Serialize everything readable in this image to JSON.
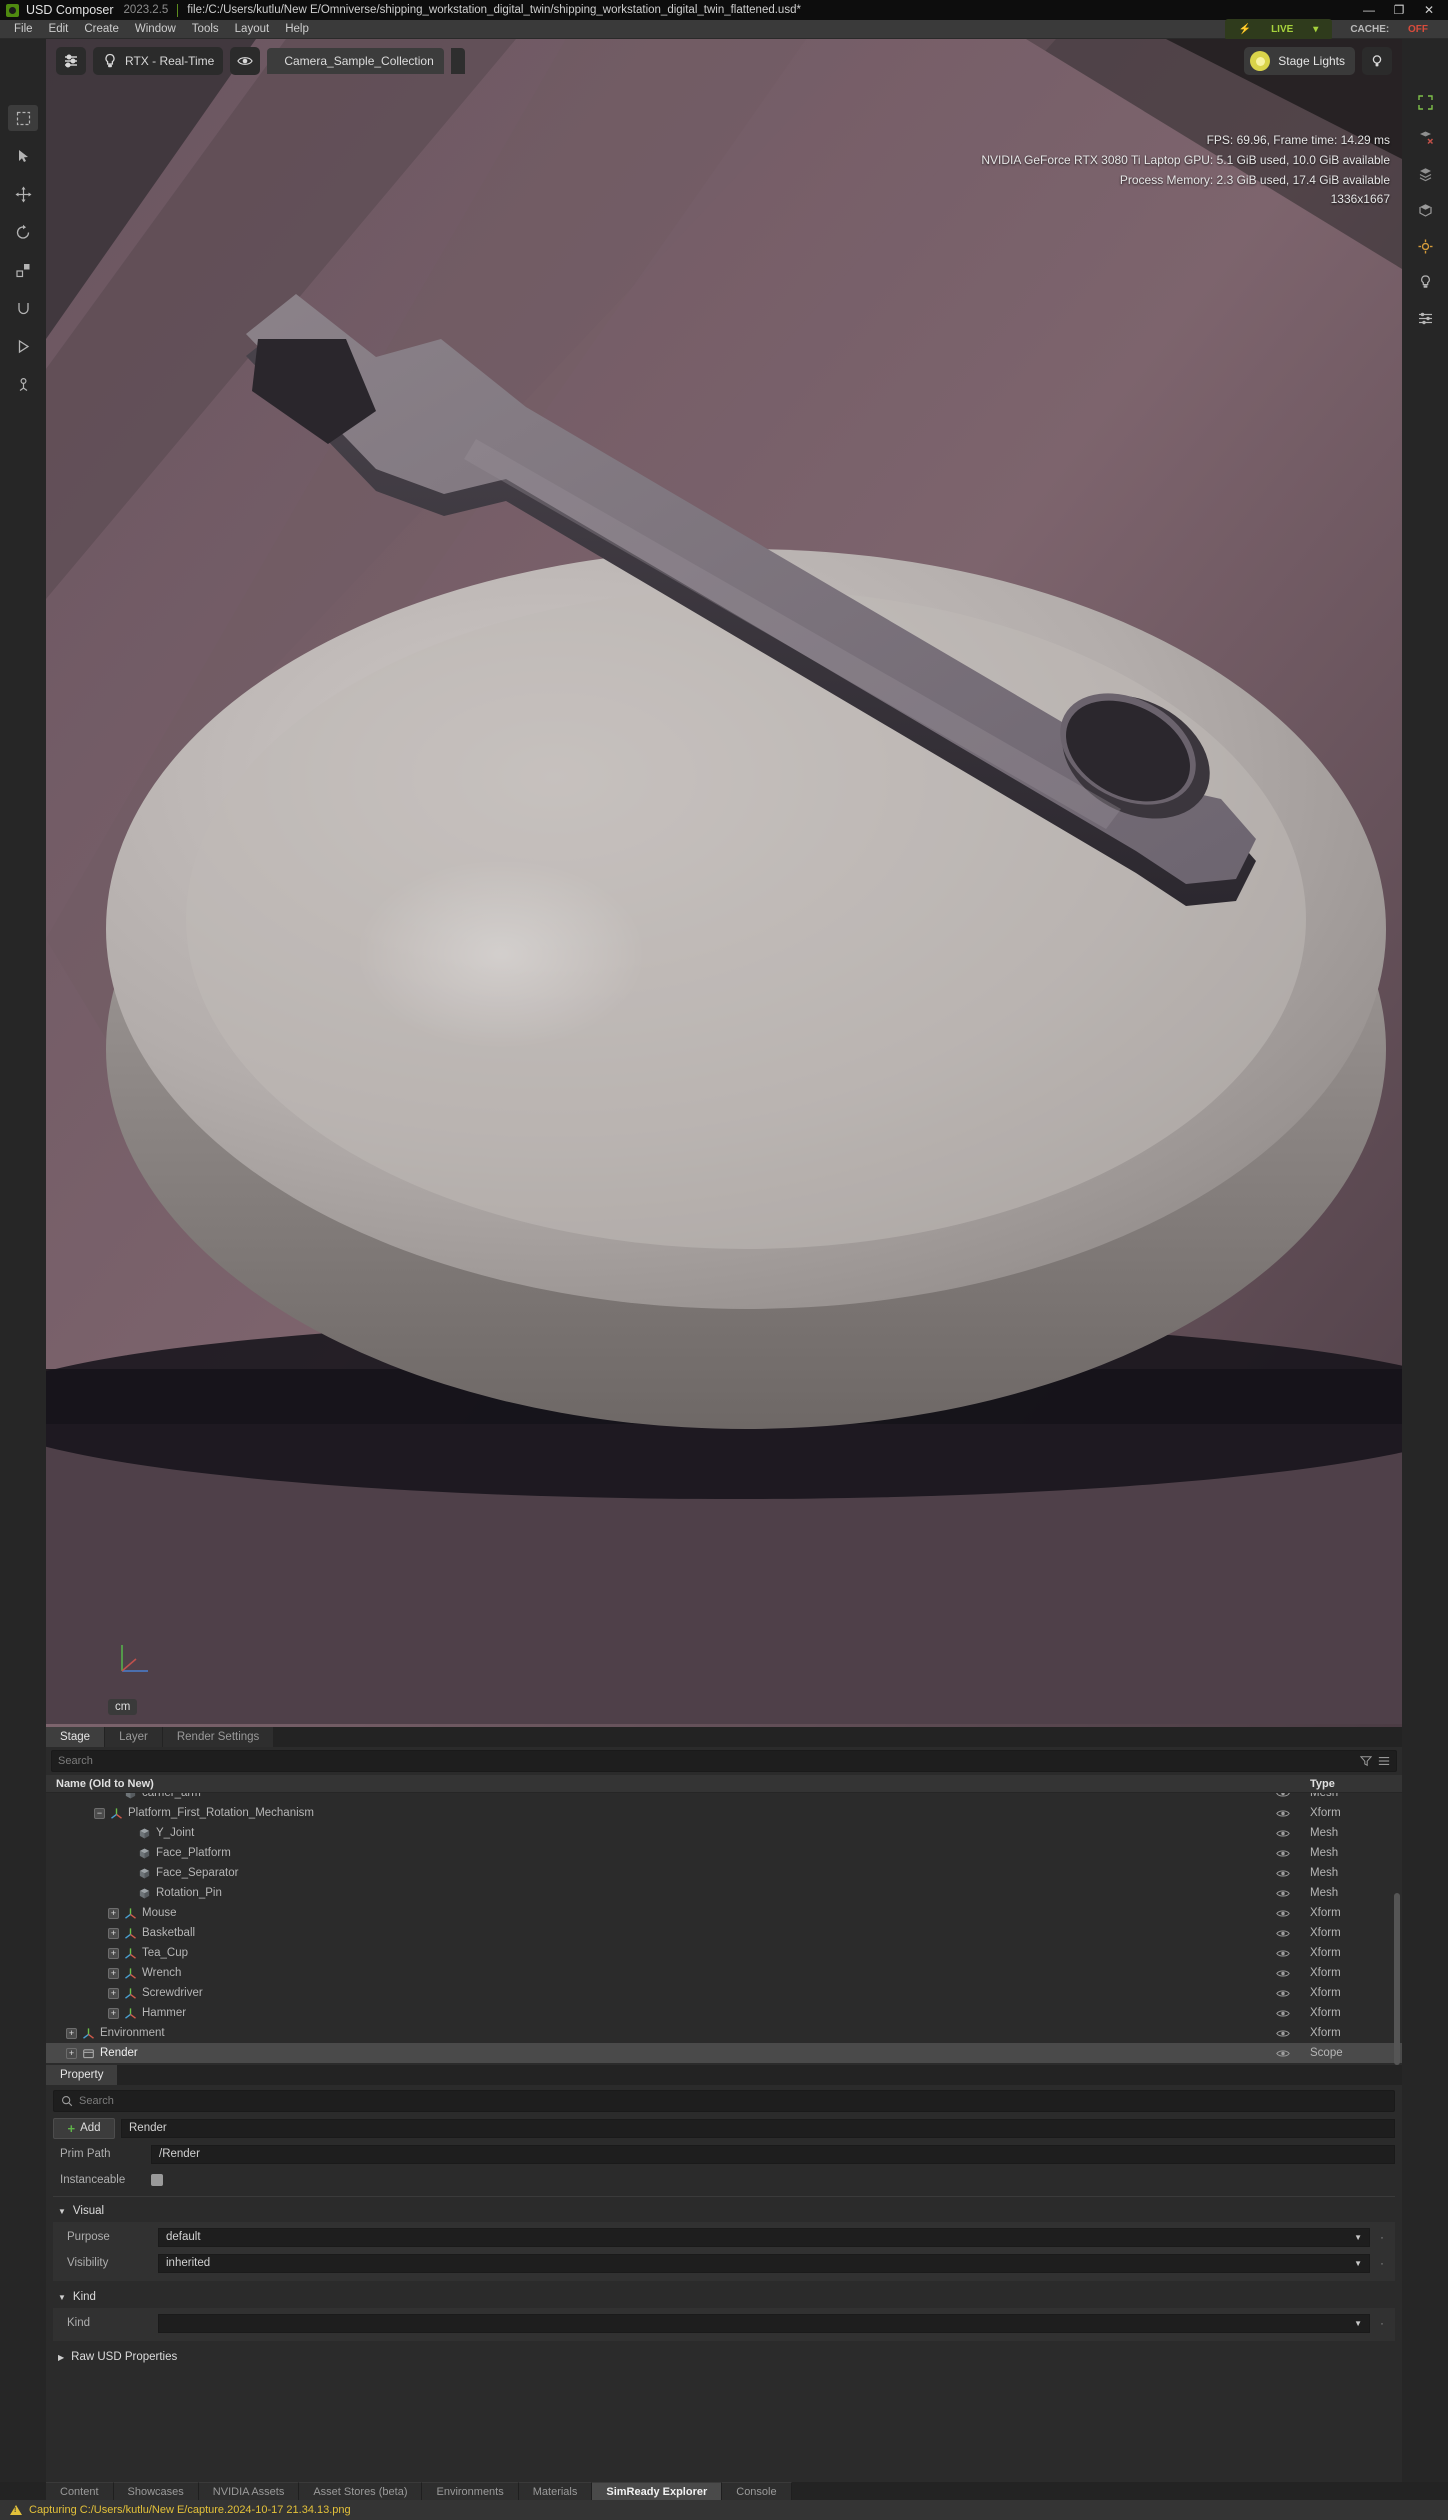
{
  "titlebar": {
    "app_name": "USD Composer",
    "version": "2023.2.5",
    "file_path": "file:/C:/Users/kutlu/New E/Omniverse/shipping_workstation_digital_twin/shipping_workstation_digital_twin_flattened.usd*",
    "minimize": "—",
    "maximize": "❐",
    "close": "✕"
  },
  "status_top": {
    "live_label": "LIVE",
    "live_caret": "▾",
    "cache_label": "CACHE:",
    "cache_value": "OFF"
  },
  "menubar": {
    "items": [
      "File",
      "Edit",
      "Create",
      "Window",
      "Tools",
      "Layout",
      "Help"
    ]
  },
  "viewport": {
    "settings_tooltip": "viewport-settings",
    "renderer": "RTX - Real-Time",
    "camera": "Camera_Sample_Collection",
    "stage_lights": "Stage Lights",
    "unit": "cm",
    "hud": [
      "FPS: 69.96, Frame time: 14.29 ms",
      "NVIDIA GeForce RTX 3080 Ti Laptop GPU: 5.1 GiB used, 10.0 GiB available",
      "Process Memory: 2.3 GiB used, 17.4 GiB available",
      "1336x1667"
    ]
  },
  "left_rail": {
    "items": [
      {
        "name": "select-rect-tool"
      },
      {
        "name": "cursor-select-tool"
      },
      {
        "name": "move-tool"
      },
      {
        "name": "rotate-tool"
      },
      {
        "name": "scale-tool"
      },
      {
        "name": "snap-tool"
      },
      {
        "name": "play-tool"
      },
      {
        "name": "physics-tool"
      }
    ]
  },
  "right_rail": {
    "items": [
      {
        "name": "expand-viewport-icon"
      },
      {
        "name": "remove-layer-icon"
      },
      {
        "name": "layers-icon"
      },
      {
        "name": "geometry-icon"
      },
      {
        "name": "render-settings-icon"
      },
      {
        "name": "lighting-icon"
      },
      {
        "name": "sliders-icon"
      }
    ]
  },
  "stage": {
    "tabs": [
      {
        "label": "Stage",
        "active": true
      },
      {
        "label": "Layer",
        "active": false
      },
      {
        "label": "Render Settings",
        "active": false
      }
    ],
    "search_placeholder": "Search",
    "filter_icon": "filter-icon",
    "options_icon": "options-icon",
    "columns": {
      "name": "Name (Old to New)",
      "type": "Type"
    },
    "rows": [
      {
        "label": "carrier_arm",
        "type": "Mesh",
        "indent": 4,
        "expander": "none",
        "icon": "mesh",
        "clipped": true,
        "selected": false
      },
      {
        "label": "Platform_First_Rotation_Mechanism",
        "type": "Xform",
        "indent": 3,
        "expander": "minus",
        "icon": "xform",
        "selected": false
      },
      {
        "label": "Y_Joint",
        "type": "Mesh",
        "indent": 5,
        "expander": "none",
        "icon": "mesh",
        "selected": false
      },
      {
        "label": "Face_Platform",
        "type": "Mesh",
        "indent": 5,
        "expander": "none",
        "icon": "mesh",
        "selected": false
      },
      {
        "label": "Face_Separator",
        "type": "Mesh",
        "indent": 5,
        "expander": "none",
        "icon": "mesh",
        "selected": false
      },
      {
        "label": "Rotation_Pin",
        "type": "Mesh",
        "indent": 5,
        "expander": "none",
        "icon": "mesh",
        "selected": false
      },
      {
        "label": "Mouse",
        "type": "Xform",
        "indent": 4,
        "expander": "plus",
        "icon": "xform",
        "selected": false
      },
      {
        "label": "Basketball",
        "type": "Xform",
        "indent": 4,
        "expander": "plus",
        "icon": "xform",
        "selected": false
      },
      {
        "label": "Tea_Cup",
        "type": "Xform",
        "indent": 4,
        "expander": "plus",
        "icon": "xform",
        "selected": false
      },
      {
        "label": "Wrench",
        "type": "Xform",
        "indent": 4,
        "expander": "plus",
        "icon": "xform",
        "selected": false
      },
      {
        "label": "Screwdriver",
        "type": "Xform",
        "indent": 4,
        "expander": "plus",
        "icon": "xform",
        "selected": false
      },
      {
        "label": "Hammer",
        "type": "Xform",
        "indent": 4,
        "expander": "plus",
        "icon": "xform",
        "selected": false
      },
      {
        "label": "Environment",
        "type": "Xform",
        "indent": 1,
        "expander": "plus",
        "icon": "xform",
        "selected": false
      },
      {
        "label": "Render",
        "type": "Scope",
        "indent": 1,
        "expander": "plus",
        "icon": "scope",
        "selected": true
      }
    ]
  },
  "property": {
    "tab_label": "Property",
    "search_placeholder": "Search",
    "add_label": "Add",
    "name_value": "Render",
    "prim_path_label": "Prim Path",
    "prim_path_value": "/Render",
    "instanceable_label": "Instanceable",
    "sections": [
      {
        "title": "Visual",
        "expanded": true,
        "rows": [
          {
            "label": "Purpose",
            "value": "default",
            "type": "combo"
          },
          {
            "label": "Visibility",
            "value": "inherited",
            "type": "combo"
          }
        ]
      },
      {
        "title": "Kind",
        "expanded": true,
        "rows": [
          {
            "label": "Kind",
            "value": "",
            "type": "combo"
          }
        ]
      },
      {
        "title": "Raw USD Properties",
        "expanded": false,
        "rows": []
      }
    ]
  },
  "bottom_tabs": [
    {
      "label": "Content",
      "active": false
    },
    {
      "label": "Showcases",
      "active": false
    },
    {
      "label": "NVIDIA Assets",
      "active": false
    },
    {
      "label": "Asset Stores (beta)",
      "active": false
    },
    {
      "label": "Environments",
      "active": false
    },
    {
      "label": "Materials",
      "active": false
    },
    {
      "label": "SimReady Explorer",
      "active": true
    },
    {
      "label": "Console",
      "active": false
    }
  ],
  "statusbar": {
    "message": "Capturing C:/Users/kutlu/New E/capture.2024-10-17 21.34.13.png"
  },
  "colors": {
    "accent_green": "#76b900",
    "warning": "#e3c13a",
    "cache_off": "#d94c3c",
    "selection": "#4a4a4a"
  }
}
